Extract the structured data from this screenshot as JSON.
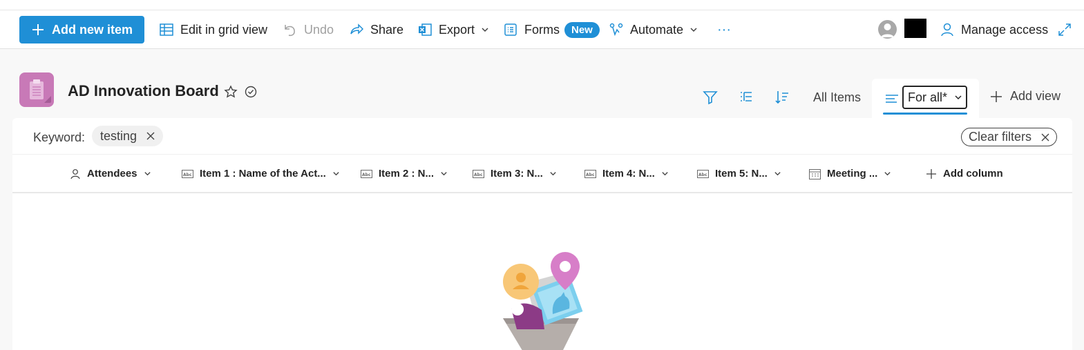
{
  "toolbar": {
    "add_new_item": "Add new item",
    "edit_grid": "Edit in grid view",
    "undo": "Undo",
    "share": "Share",
    "export": "Export",
    "forms": "Forms",
    "forms_badge": "New",
    "automate": "Automate",
    "more": "···",
    "manage_access": "Manage access"
  },
  "header": {
    "title": "AD Innovation Board",
    "view_all_items": "All Items",
    "view_current": "For all*",
    "add_view": "Add view"
  },
  "filters": {
    "keyword_label": "Keyword:",
    "keyword_value": "testing",
    "clear_filters": "Clear filters"
  },
  "columns": [
    {
      "label": "Attendees",
      "icon": "person-icon"
    },
    {
      "label": "Item 1 : Name of the Act...",
      "icon": "text-field-icon"
    },
    {
      "label": "Item 2 : N...",
      "icon": "text-field-icon"
    },
    {
      "label": "Item 3: N...",
      "icon": "text-field-icon"
    },
    {
      "label": "Item 4: N...",
      "icon": "text-field-icon"
    },
    {
      "label": "Item 5: N...",
      "icon": "text-field-icon"
    },
    {
      "label": "Meeting ...",
      "icon": "calendar-icon"
    },
    {
      "label": "Add column",
      "icon": "plus-icon"
    }
  ],
  "colors": {
    "accent": "#1f8fd6",
    "site_icon": "#c879b7"
  }
}
